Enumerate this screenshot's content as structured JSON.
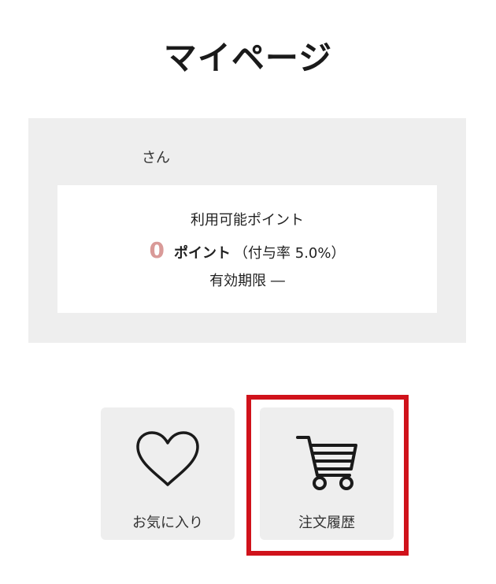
{
  "page": {
    "title": "マイページ"
  },
  "member": {
    "name_suffix": "さん",
    "points": {
      "label": "利用可能ポイント",
      "value": "0",
      "unit": "ポイント",
      "rate_text": "（付与率 5.0%）",
      "expiry": "有効期限 ―"
    }
  },
  "menu": {
    "tiles": [
      {
        "label": "お気に入り",
        "icon": "heart-icon"
      },
      {
        "label": "注文履歴",
        "icon": "cart-icon"
      }
    ]
  },
  "colors": {
    "panel_bg": "#eeeeee",
    "points_value": "#d99a98",
    "highlight": "#d0121b"
  }
}
